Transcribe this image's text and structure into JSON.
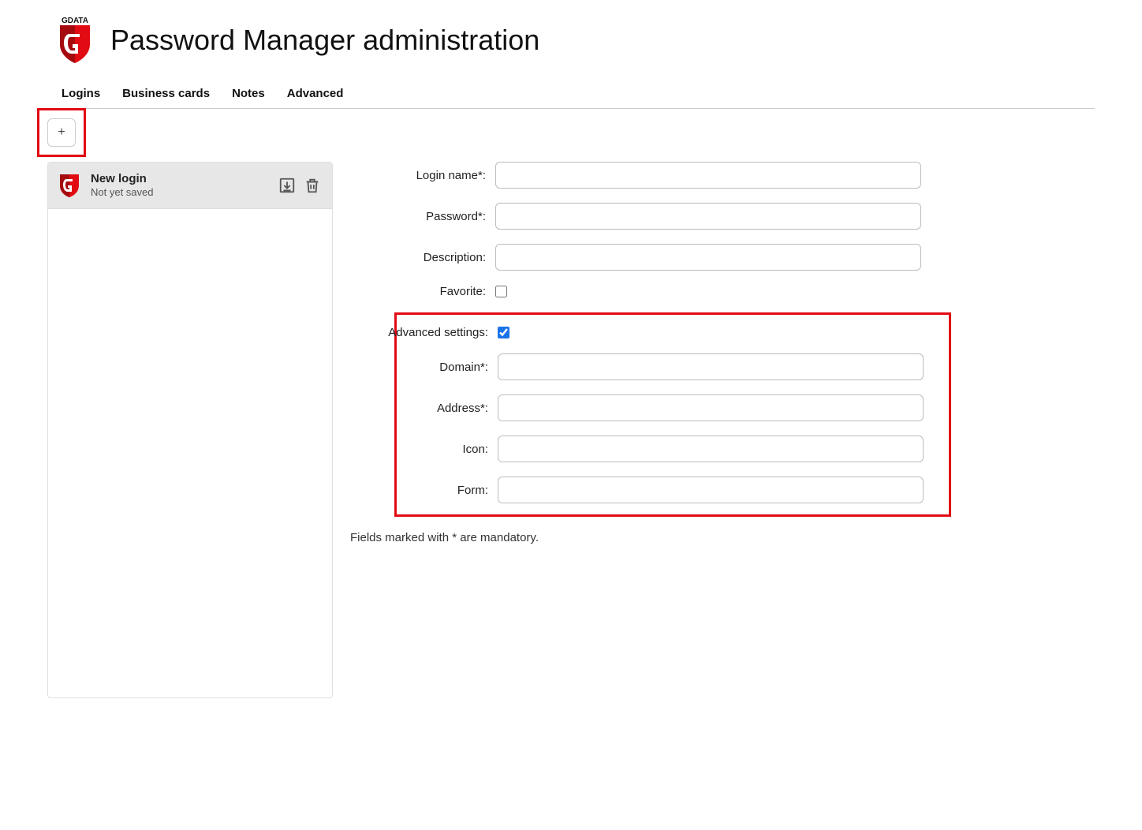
{
  "header": {
    "brand_top": "GDATA",
    "title": "Password Manager administration"
  },
  "tabs": {
    "logins": "Logins",
    "business_cards": "Business cards",
    "notes": "Notes",
    "advanced": "Advanced"
  },
  "toolbar": {
    "add_label": "+"
  },
  "list": {
    "items": [
      {
        "title": "New login",
        "subtitle": "Not yet saved"
      }
    ]
  },
  "form": {
    "login_name_label": "Login name*:",
    "password_label": "Password*:",
    "description_label": "Description:",
    "favorite_label": "Favorite:",
    "advanced_settings_label": "Advanced settings:",
    "domain_label": "Domain*:",
    "address_label": "Address*:",
    "icon_label": "Icon:",
    "form_label": "Form:",
    "login_name_value": "",
    "password_value": "",
    "description_value": "",
    "favorite_checked": false,
    "advanced_checked": true,
    "domain_value": "",
    "address_value": "",
    "icon_value": "",
    "form_value": "",
    "hint": "Fields marked with * are mandatory."
  },
  "colors": {
    "brand_red": "#e20b13",
    "brand_red_dark": "#a50a0f",
    "highlight": "#e20b13"
  }
}
